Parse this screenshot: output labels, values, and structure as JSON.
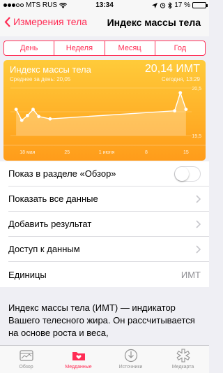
{
  "status_bar": {
    "carrier": "MTS RUS",
    "time": "13:34",
    "battery": "17 %",
    "battery_level": 0.17
  },
  "nav": {
    "back_label": "Измерения тела",
    "title": "Индекс массы тела"
  },
  "segments": [
    {
      "label": "День",
      "active": false
    },
    {
      "label": "Неделя",
      "active": false
    },
    {
      "label": "Месяц",
      "active": true
    },
    {
      "label": "Год",
      "active": false
    }
  ],
  "chart": {
    "title": "Индекс массы тела",
    "subtitle": "Среднее за день: 20,05",
    "value": "20,14 ИМТ",
    "today": "Сегодня, 13:29",
    "colors": {
      "top": "#ffcb3a",
      "bottom": "#ff9c1a",
      "line": "#ffffff"
    }
  },
  "chart_data": {
    "type": "area",
    "x_ticks": [
      "18 мая",
      "25",
      "1 июня",
      "8",
      "15"
    ],
    "y_ticks": [
      "20,5",
      "19,5"
    ],
    "ylim": [
      19.5,
      20.5
    ],
    "x": [
      "2015-05-16",
      "2015-05-17",
      "2015-05-18",
      "2015-05-19",
      "2015-05-20",
      "2015-05-22",
      "2015-06-13",
      "2015-06-14",
      "2015-06-15"
    ],
    "values": [
      20.05,
      19.82,
      19.92,
      20.05,
      19.9,
      19.85,
      20.02,
      20.4,
      20.05
    ],
    "grid": true
  },
  "list": {
    "overview": "Показ в разделе «Обзор»",
    "show_all": "Показать все данные",
    "add": "Добавить результат",
    "access": "Доступ к данным",
    "units_label": "Единицы",
    "units_value": "ИМТ"
  },
  "description": "Индекс массы тела (ИМТ) — индикатор Вашего телесного жира. Он рассчитывается на основе роста и веса,",
  "tabs": [
    {
      "label": "Обзор",
      "icon": "dashboard-icon",
      "active": false
    },
    {
      "label": "Медданные",
      "icon": "health-data-icon",
      "active": true
    },
    {
      "label": "Источники",
      "icon": "sources-icon",
      "active": false
    },
    {
      "label": "Медкарта",
      "icon": "medical-id-icon",
      "active": false
    }
  ]
}
